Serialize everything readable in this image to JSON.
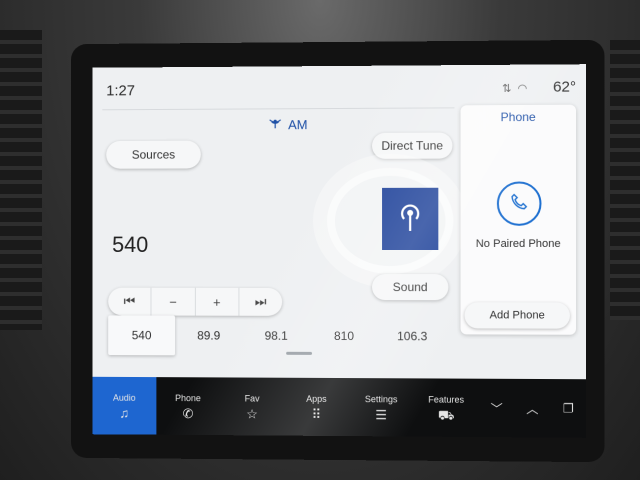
{
  "status": {
    "time": "1:27",
    "temperature": "62°"
  },
  "audio": {
    "band": "AM",
    "sources_label": "Sources",
    "direct_tune_label": "Direct Tune",
    "frequency": "540",
    "sound_label": "Sound",
    "controls": {
      "seek_back": "⏮",
      "minus": "−",
      "plus": "+",
      "seek_forward": "⏭"
    },
    "presets": [
      "540",
      "89.9",
      "98.1",
      "810",
      "106.3"
    ],
    "active_preset_index": 0
  },
  "phone": {
    "title": "Phone",
    "status": "No Paired Phone",
    "add_label": "Add Phone"
  },
  "nav": {
    "items": [
      {
        "label": "Audio",
        "icon": "music-note-icon",
        "glyph": "♫"
      },
      {
        "label": "Phone",
        "icon": "phone-icon",
        "glyph": "✆"
      },
      {
        "label": "Fav",
        "icon": "star-icon",
        "glyph": "☆"
      },
      {
        "label": "Apps",
        "icon": "apps-grid-icon",
        "glyph": "⠿"
      },
      {
        "label": "Settings",
        "icon": "settings-sliders-icon",
        "glyph": "☰"
      },
      {
        "label": "Features",
        "icon": "car-icon",
        "glyph": "⛟"
      }
    ],
    "extra": [
      "chevron-down-icon",
      "chevron-up-icon",
      "copy-icon"
    ]
  },
  "colors": {
    "accent": "#1e66d0",
    "station_art": "#21449b",
    "brand_blue": "#1d4fa6"
  }
}
